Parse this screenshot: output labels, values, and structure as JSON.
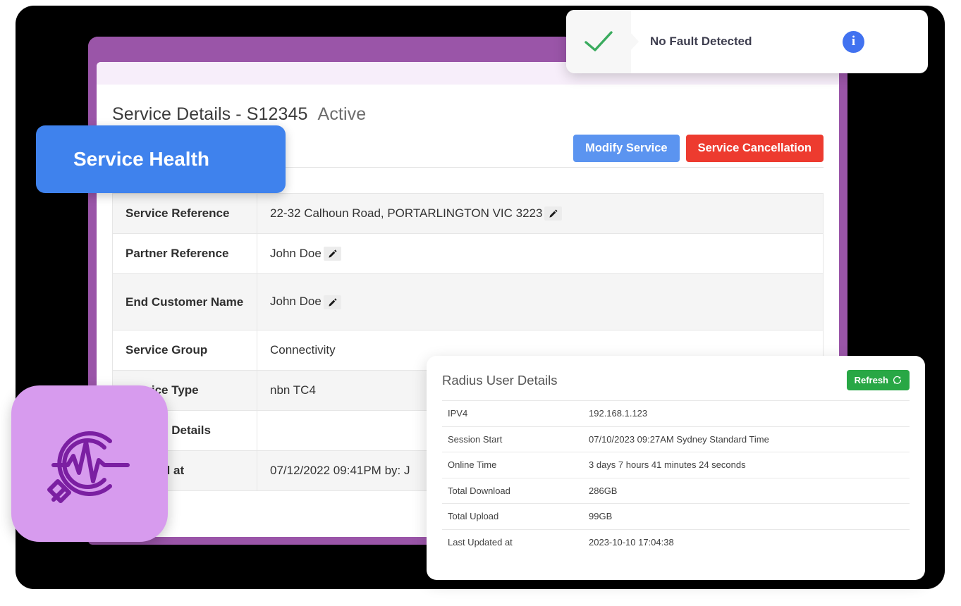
{
  "fault_banner": {
    "check_icon": "check-icon",
    "message": "No Fault Detected",
    "info_icon": "i"
  },
  "service_health_pill": {
    "label": "Service Health"
  },
  "health_tile": {
    "icon": "service-health-pulse-magnifier-icon"
  },
  "page": {
    "title": "Service Details - S12345",
    "status": "Active",
    "buttons": {
      "modify": "Modify Service",
      "cancel": "Service Cancellation"
    }
  },
  "details": {
    "rows": [
      {
        "key": "Service Reference",
        "value": "22-32 Calhoun Road, PORTARLINGTON VIC 3223",
        "editable": true
      },
      {
        "key": "Partner Reference",
        "value": "John Doe",
        "editable": true
      },
      {
        "key": "End Customer Name",
        "value": "John Doe",
        "editable": true
      },
      {
        "key": "Service Group",
        "value": "Connectivity",
        "editable": false
      },
      {
        "key": "Service Type",
        "value": "nbn TC4",
        "editable": false
      },
      {
        "key": "Service Details",
        "value": "",
        "editable": false
      },
      {
        "key": "Created at",
        "value": "07/12/2022 09:41PM by: J",
        "editable": false
      }
    ]
  },
  "radius": {
    "title": "Radius User Details",
    "refresh_label": "Refresh",
    "refresh_icon": "refresh-icon",
    "rows": [
      {
        "key": "IPV4",
        "value": "192.168.1.123"
      },
      {
        "key": "Session Start",
        "value": "07/10/2023 09:27AM Sydney Standard Time"
      },
      {
        "key": "Online Time",
        "value": "3 days 7 hours 41 minutes 24 seconds"
      },
      {
        "key": "Total Download",
        "value": "286GB"
      },
      {
        "key": "Total Upload",
        "value": "99GB"
      },
      {
        "key": "Last Updated at",
        "value": "2023-10-10 17:04:38"
      }
    ]
  },
  "colors": {
    "window_frame": "#9a55a8",
    "pill_blue": "#3f82ed",
    "tile_purple": "#d79bee",
    "tile_icon": "#7b1fa2",
    "modify_blue": "#5b94f0",
    "cancel_red": "#ed3b2f",
    "refresh_green": "#28a745",
    "check_green": "#3aab5e",
    "info_blue": "#4172f0"
  }
}
